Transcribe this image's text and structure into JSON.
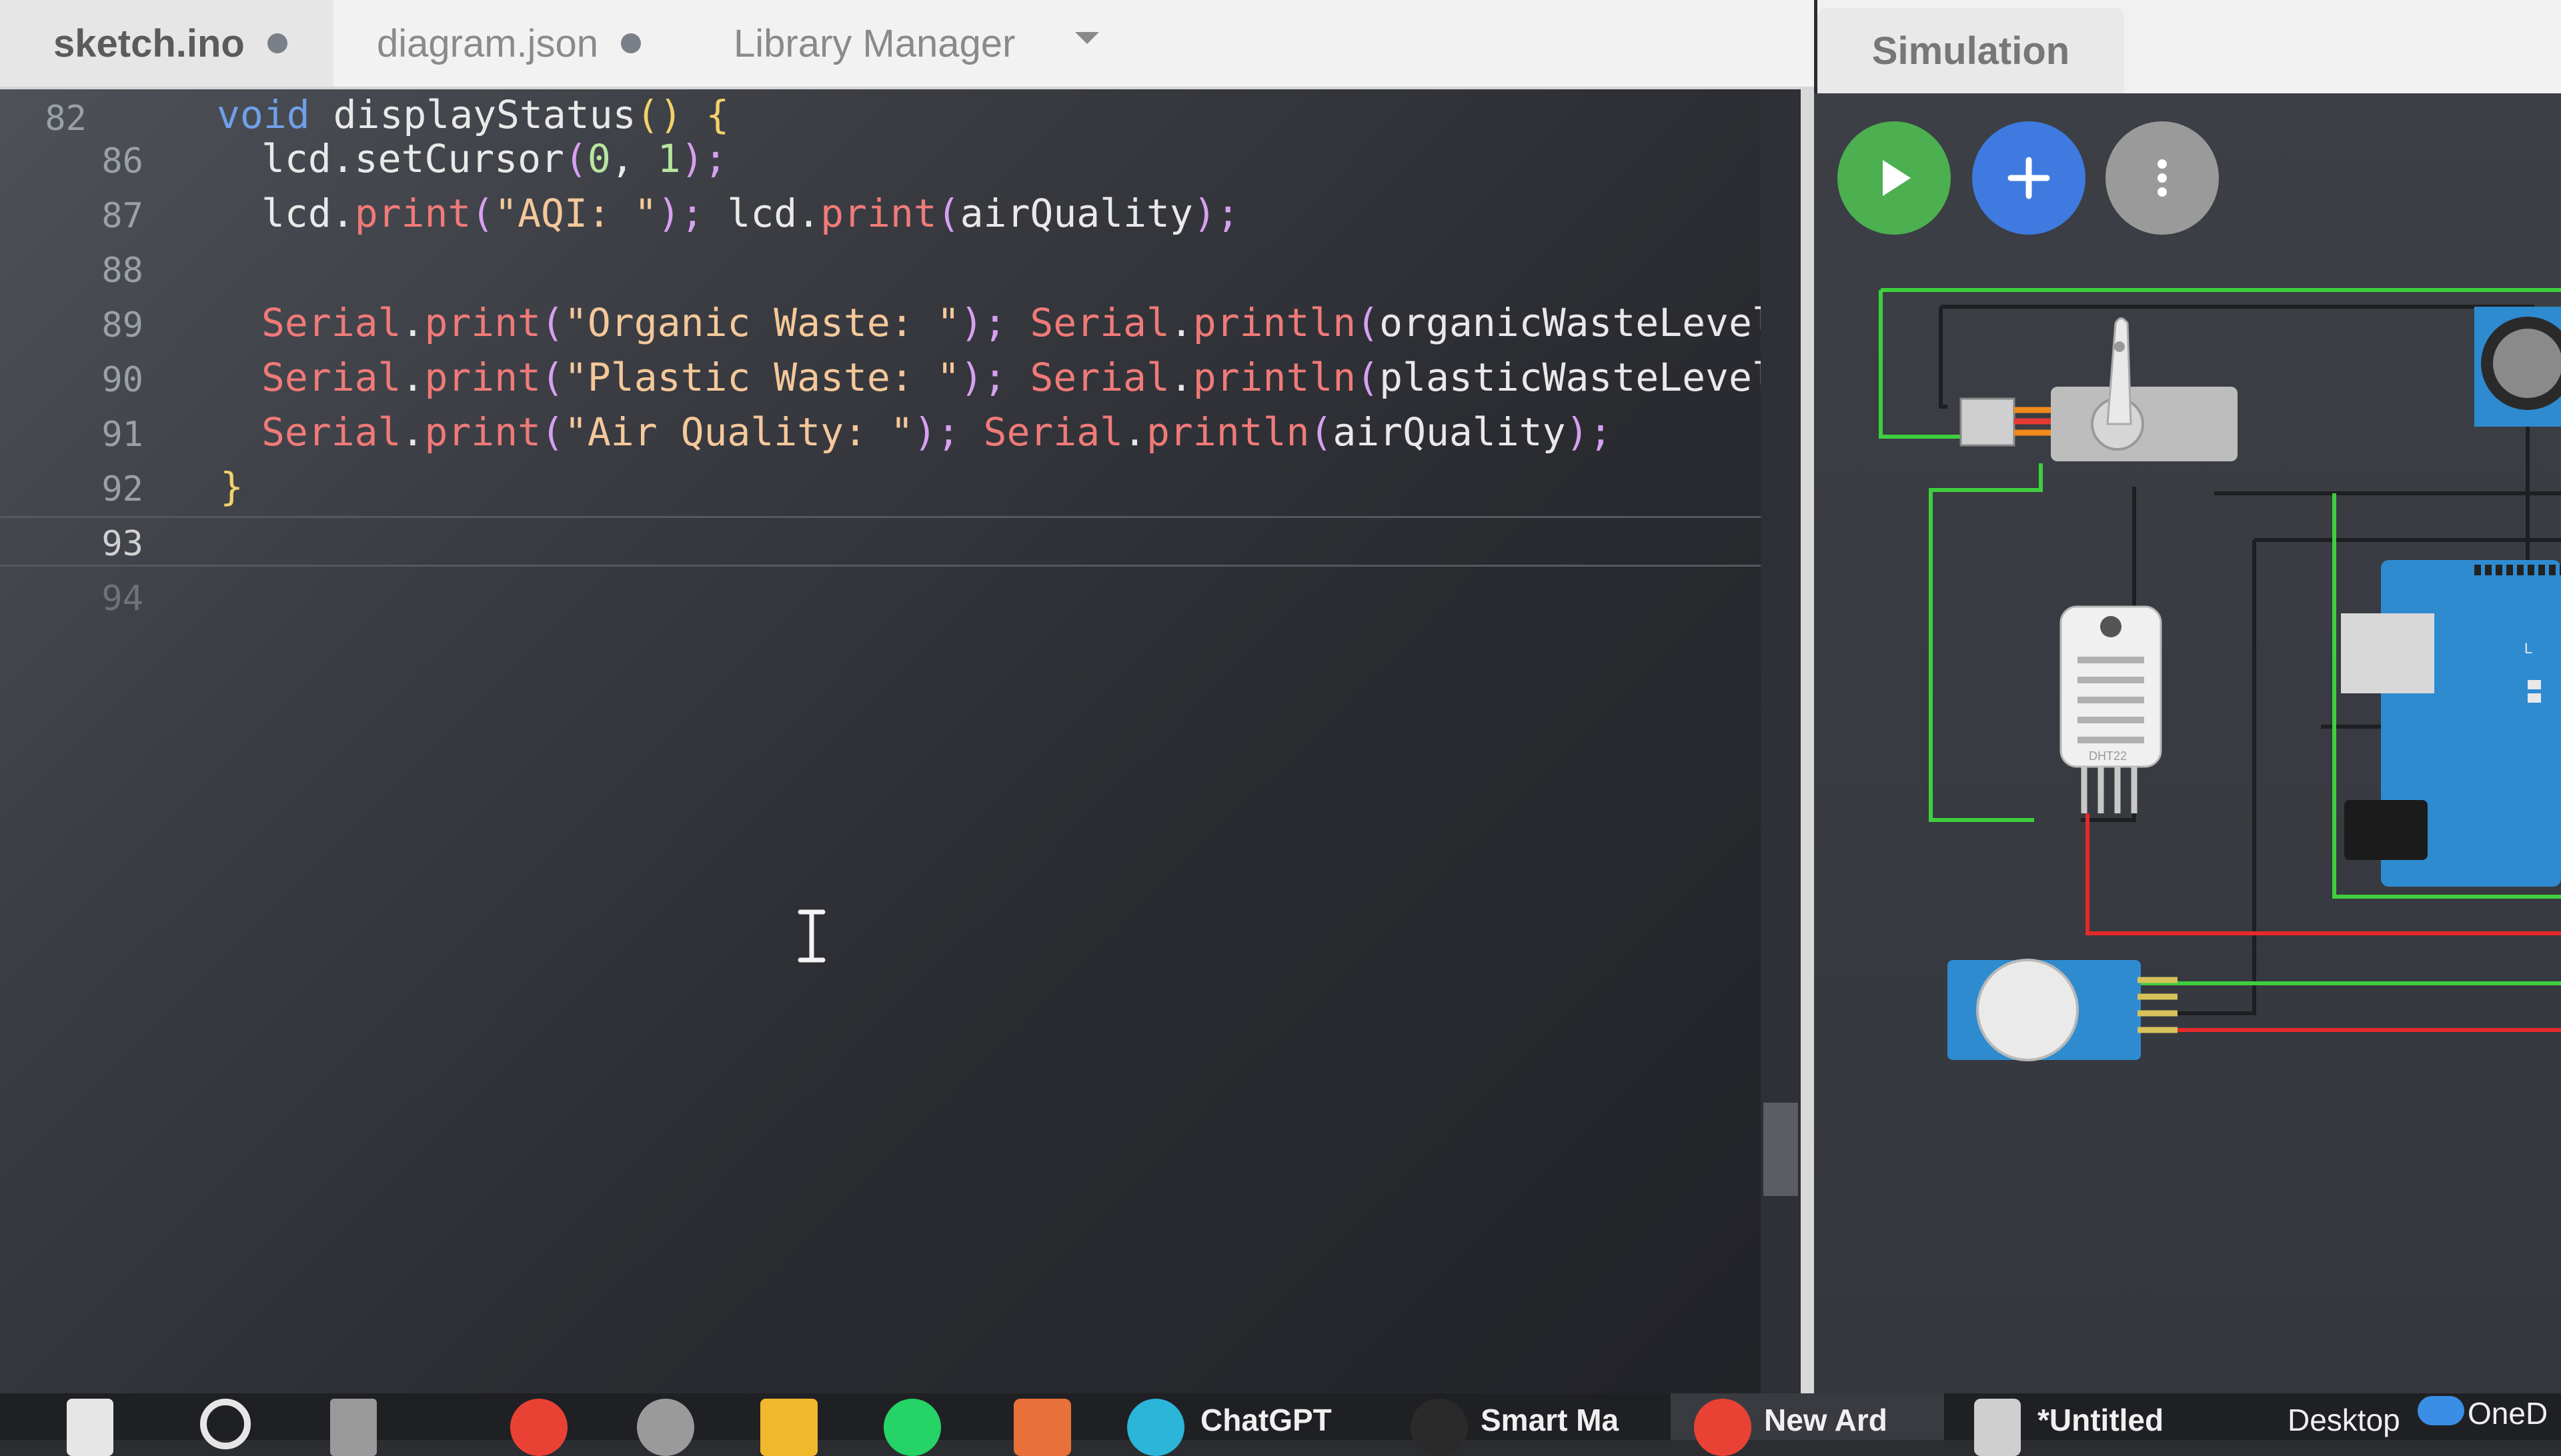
{
  "tabs": [
    {
      "label": "sketch.ino",
      "active": true,
      "modified": true
    },
    {
      "label": "diagram.json",
      "active": false,
      "modified": true
    },
    {
      "label": "Library Manager",
      "active": false,
      "modified": false
    }
  ],
  "simulation": {
    "tab_label": "Simulation",
    "play_icon": "play-icon",
    "add_icon": "plus-icon",
    "more_icon": "more-vertical-icon"
  },
  "editor": {
    "line_numbers": [
      "82",
      "86",
      "87",
      "88",
      "89",
      "90",
      "91",
      "92",
      "93",
      "94"
    ],
    "lines": {
      "l82": {
        "kw": "void",
        "fn": " displayStatus",
        "paren": "()",
        "brace": " {"
      },
      "l86": {
        "obj": "lcd.setCursor",
        "open": "(",
        "a": "0",
        "comma": ", ",
        "b": "1",
        "close": ");"
      },
      "l87": {
        "obj1": "lcd.",
        "fn1": "print",
        "open1": "(",
        "str": "\"AQI: \"",
        "close1": ");",
        "obj2": " lcd.",
        "fn2": "print",
        "open2": "(",
        "arg": "airQuality",
        "close2": ");"
      },
      "l89": {
        "cls": "Serial",
        "dot1": ".",
        "fn1": "print",
        "open1": "(",
        "str": "\"Organic Waste: \"",
        "close1": ");",
        "cls2": " Serial",
        "dot2": ".",
        "fn2": "println",
        "open2": "(",
        "arg": "organicWasteLevel",
        "close2": ");"
      },
      "l90": {
        "cls": "Serial",
        "dot1": ".",
        "fn1": "print",
        "open1": "(",
        "str": "\"Plastic Waste: \"",
        "close1": ");",
        "cls2": " Serial",
        "dot2": ".",
        "fn2": "println",
        "open2": "(",
        "arg": "plasticWasteLevel",
        "close2": ");"
      },
      "l91": {
        "cls": "Serial",
        "dot1": ".",
        "fn1": "print",
        "open1": "(",
        "str": "\"Air Quality: \"",
        "close1": ");",
        "cls2": " Serial",
        "dot2": ".",
        "fn2": "println",
        "open2": "(",
        "arg": "airQuality",
        "close2": ");"
      },
      "l92": {
        "brace": "}"
      }
    },
    "overflow_hint": ")"
  },
  "circuit": {
    "sensor_label": "DHT22"
  },
  "taskbar": {
    "items": [
      {
        "label": "ChatGPT"
      },
      {
        "label": "Smart Ma"
      },
      {
        "label": "New Ard"
      },
      {
        "label": "*Untitled"
      },
      {
        "label": "Desktop"
      },
      {
        "label": "OneD"
      }
    ]
  },
  "colors": {
    "play": "#4caf50",
    "add": "#3f7ae0",
    "wire_green": "#3ecf3e",
    "wire_red": "#e52a2a",
    "arduino_blue": "#2e8bd0"
  }
}
